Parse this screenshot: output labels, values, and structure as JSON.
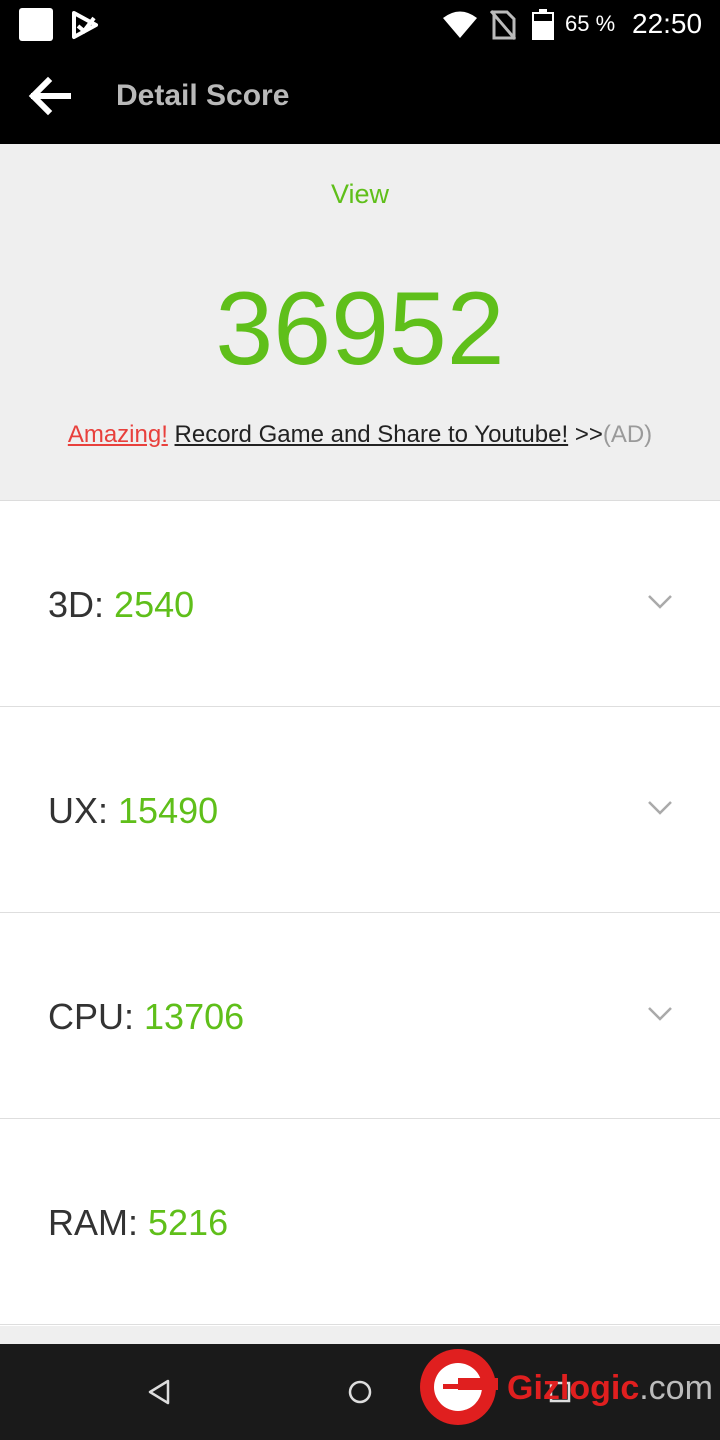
{
  "status_bar": {
    "battery_percent": "65 %",
    "time": "22:50",
    "icons": [
      "notification-square-icon",
      "play-store-icon",
      "wifi-icon",
      "no-sim-icon",
      "battery-icon"
    ]
  },
  "app_bar": {
    "back_icon": "back-arrow-icon",
    "title": "Detail Score"
  },
  "summary": {
    "view_label": "View",
    "total_score": "36952",
    "ad": {
      "amazing": "Amazing!",
      "text": "Record Game and Share to Youtube!",
      "arrows": ">>",
      "tag": "(AD)"
    }
  },
  "scores": [
    {
      "label": "3D:",
      "value": "2540",
      "expandable": true
    },
    {
      "label": "UX:",
      "value": "15490",
      "expandable": true
    },
    {
      "label": "CPU:",
      "value": "13706",
      "expandable": true
    },
    {
      "label": "RAM:",
      "value": "5216",
      "expandable": false
    }
  ],
  "nav_bar": {
    "icons": [
      "back-triangle-icon",
      "home-circle-icon",
      "recents-square-icon"
    ]
  },
  "watermark": {
    "brand": "Gizlogic",
    "suffix": ".com"
  },
  "colors": {
    "accent_green": "#5fbf1a",
    "ad_red": "#e8403c",
    "watermark_red": "#e01f1f"
  }
}
